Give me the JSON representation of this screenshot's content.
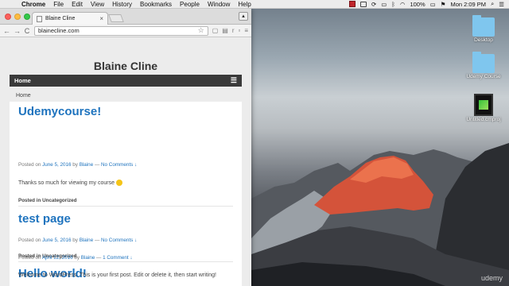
{
  "menubar": {
    "app_name": "Chrome",
    "items": [
      "File",
      "Edit",
      "View",
      "History",
      "Bookmarks",
      "People",
      "Window",
      "Help"
    ],
    "battery": "100%",
    "clock": "Mon 2:09 PM"
  },
  "browser": {
    "tab_title": "Blaine Cline",
    "url": "blainecline.com"
  },
  "site": {
    "title": "Blaine Cline",
    "nav_home": "Home",
    "breadcrumb": "Home"
  },
  "posts": [
    {
      "title": "Udemycourse!",
      "posted_on": "Posted on",
      "date": "June 5, 2016",
      "by": "by",
      "author": "Blaine",
      "dash": "—",
      "comments": "No Comments ↓",
      "body": "Thanks so much for viewing my course",
      "posted_in": "Posted in Uncategorized"
    },
    {
      "title": "test page",
      "posted_on": "Posted on",
      "date": "June 5, 2016",
      "by": "by",
      "author": "Blaine",
      "dash": "—",
      "comments": "No Comments ↓",
      "posted_in": "Posted in Uncategorized"
    },
    {
      "title": "Hello world!",
      "posted_on": "Posted on",
      "date": "April 12, 2016",
      "by": "by",
      "author": "Blaine",
      "dash": "—",
      "comments": "1 Comment ↓",
      "body": "Welcome to WordPress. This is your first post. Edit or delete it, then start writing!"
    }
  ],
  "desktop": {
    "icons": [
      "Desktop",
      "Udemy Course",
      "Untitled.cmproj"
    ],
    "watermark": "udemy"
  }
}
